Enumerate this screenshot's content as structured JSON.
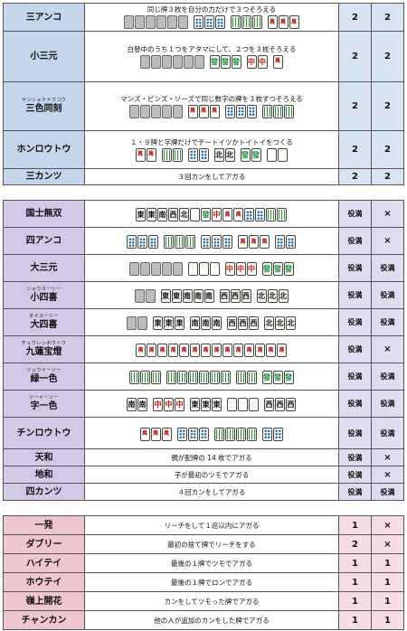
{
  "sections": [
    {
      "id": "s1",
      "rows": [
        {
          "name": "三アンコ",
          "ruby": "",
          "desc": "同じ牌３枚を自分の力だけで３つそろえる",
          "closed": "2",
          "open": "2",
          "tiles": true
        },
        {
          "name": "小三元",
          "ruby": "",
          "desc": "白發中のうち１つをアタマにして、２つを３枚そろえる",
          "closed": "2",
          "open": "2",
          "tiles": true
        },
        {
          "name": "三色同刻",
          "ruby": "サンショクドウコウ",
          "desc": "マンズ・ピンズ・ソーズで同じ数字の牌を３枚ずつそろえる",
          "closed": "2",
          "open": "2",
          "tiles": true
        },
        {
          "name": "ホンロウトウ",
          "ruby": "",
          "desc": "１・９牌と字牌だけでチートイツかトイトイをつくる",
          "closed": "2",
          "open": "2",
          "tiles": true
        },
        {
          "name": "三カンツ",
          "ruby": "",
          "desc": "３回カンをしてアガる",
          "closed": "2",
          "open": "2",
          "tiles": false
        }
      ]
    },
    {
      "id": "s2",
      "rows": [
        {
          "name": "国士無双",
          "ruby": "",
          "desc": "",
          "closed": "役満",
          "open": "×"
        },
        {
          "name": "四アンコ",
          "ruby": "",
          "desc": "",
          "closed": "役満",
          "open": "×"
        },
        {
          "name": "大三元",
          "ruby": "",
          "desc": "",
          "closed": "役満",
          "open": "役満"
        },
        {
          "name": "小四喜",
          "ruby": "ショウスーシー",
          "desc": "",
          "closed": "役満",
          "open": "役満"
        },
        {
          "name": "大四喜",
          "ruby": "ダイスーシー",
          "desc": "",
          "closed": "役満",
          "open": "役満"
        },
        {
          "name": "九蓮宝燈",
          "ruby": "チュウレンポウトウ",
          "desc": "",
          "closed": "役満",
          "open": "×"
        },
        {
          "name": "緑一色",
          "ruby": "リュウイーソー",
          "desc": "",
          "closed": "役満",
          "open": "役満"
        },
        {
          "name": "字一色",
          "ruby": "ツーイーソー",
          "desc": "",
          "closed": "役満",
          "open": "役満"
        },
        {
          "name": "チンロウトウ",
          "ruby": "",
          "desc": "",
          "closed": "役満",
          "open": "役満"
        },
        {
          "name": "天和",
          "ruby": "",
          "desc": "親が配牌の 14 枚でアガる",
          "closed": "役満",
          "open": "×"
        },
        {
          "name": "地和",
          "ruby": "",
          "desc": "子が最初のツモでアガる",
          "closed": "役満",
          "open": "×"
        },
        {
          "name": "四カンツ",
          "ruby": "",
          "desc": "４回カンをしてアガる",
          "closed": "役満",
          "open": "役満"
        }
      ]
    },
    {
      "id": "s3",
      "rows": [
        {
          "name": "一発",
          "ruby": "",
          "desc": "リーチをして１巡以内にアガる",
          "closed": "1",
          "open": "×"
        },
        {
          "name": "ダブリー",
          "ruby": "",
          "desc": "最初の捨て牌でリーチをする",
          "closed": "2",
          "open": "×"
        },
        {
          "name": "ハイテイ",
          "ruby": "",
          "desc": "最後の１牌でツモでアガる",
          "closed": "1",
          "open": "1"
        },
        {
          "name": "ホウテイ",
          "ruby": "",
          "desc": "最後の１牌でロンでアガる",
          "closed": "1",
          "open": "1"
        },
        {
          "name": "嶺上開花",
          "ruby": "",
          "desc": "カンをしてツモった牌でアガる",
          "closed": "1",
          "open": "1"
        },
        {
          "name": "チャンカン",
          "ruby": "",
          "desc": "他の人が追加のカンをした牌でアガる",
          "closed": "1",
          "open": "1"
        }
      ]
    }
  ],
  "tile_glyphs": {
    "honors": [
      "東",
      "南",
      "西",
      "北",
      "中",
      "發",
      "白"
    ],
    "man": "萬"
  }
}
